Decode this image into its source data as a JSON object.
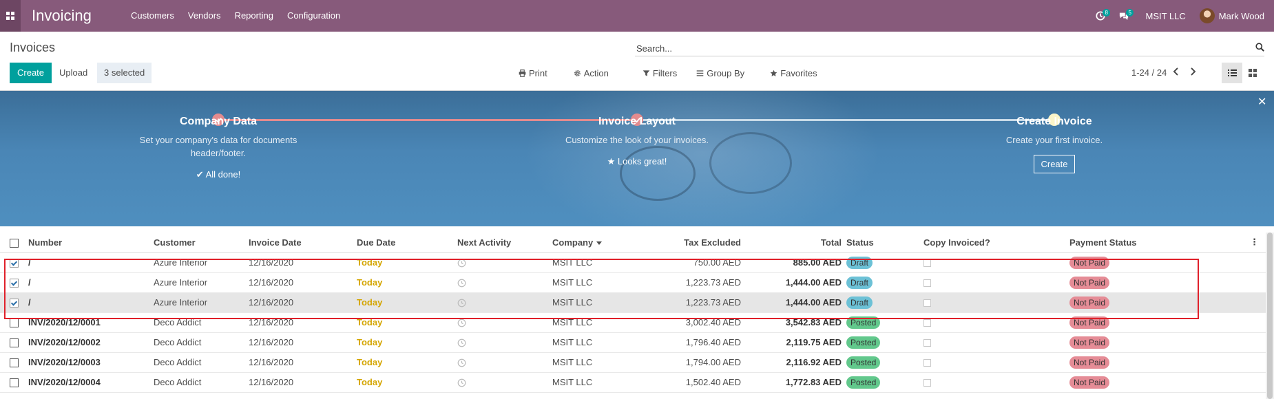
{
  "app": {
    "name": "Invoicing",
    "menu": [
      "Customers",
      "Vendors",
      "Reporting",
      "Configuration"
    ],
    "activity_badge": "8",
    "messages_badge": "5",
    "company": "MSIT LLC",
    "user": "Mark Wood"
  },
  "control_panel": {
    "breadcrumb": "Invoices",
    "search_placeholder": "Search...",
    "create_label": "Create",
    "upload_label": "Upload",
    "selected_label": "3 selected",
    "print_label": "Print",
    "action_label": "Action",
    "filters_label": "Filters",
    "groupby_label": "Group By",
    "favorites_label": "Favorites",
    "pager": "1-24 / 24"
  },
  "onboarding": {
    "steps": [
      {
        "title": "Company Data",
        "description": "Set your company's data for documents header/footer.",
        "status": "✔ All done!"
      },
      {
        "title": "Invoice Layout",
        "description": "Customize the look of your invoices.",
        "status": "★ Looks great!"
      },
      {
        "title": "Create Invoice",
        "description": "Create your first invoice.",
        "button": "Create"
      }
    ]
  },
  "table": {
    "columns": [
      "Number",
      "Customer",
      "Invoice Date",
      "Due Date",
      "Next Activity",
      "Company",
      "Tax Excluded",
      "Total",
      "Status",
      "Copy Invoiced?",
      "Payment Status"
    ],
    "rows": [
      {
        "checked": true,
        "number": "/",
        "customer": "Azure Interior",
        "invoice_date": "12/16/2020",
        "due": "Today",
        "company": "MSIT LLC",
        "tax_excluded": "750.00 AED",
        "total": "885.00 AED",
        "status": "Draft",
        "payment": "Not Paid"
      },
      {
        "checked": true,
        "number": "/",
        "customer": "Azure Interior",
        "invoice_date": "12/16/2020",
        "due": "Today",
        "company": "MSIT LLC",
        "tax_excluded": "1,223.73 AED",
        "total": "1,444.00 AED",
        "status": "Draft",
        "payment": "Not Paid"
      },
      {
        "checked": true,
        "number": "/",
        "customer": "Azure Interior",
        "invoice_date": "12/16/2020",
        "due": "Today",
        "company": "MSIT LLC",
        "tax_excluded": "1,223.73 AED",
        "total": "1,444.00 AED",
        "status": "Draft",
        "payment": "Not Paid"
      },
      {
        "checked": false,
        "number": "INV/2020/12/0001",
        "customer": "Deco Addict",
        "invoice_date": "12/16/2020",
        "due": "Today",
        "company": "MSIT LLC",
        "tax_excluded": "3,002.40 AED",
        "total": "3,542.83 AED",
        "status": "Posted",
        "payment": "Not Paid"
      },
      {
        "checked": false,
        "number": "INV/2020/12/0002",
        "customer": "Deco Addict",
        "invoice_date": "12/16/2020",
        "due": "Today",
        "company": "MSIT LLC",
        "tax_excluded": "1,796.40 AED",
        "total": "2,119.75 AED",
        "status": "Posted",
        "payment": "Not Paid"
      },
      {
        "checked": false,
        "number": "INV/2020/12/0003",
        "customer": "Deco Addict",
        "invoice_date": "12/16/2020",
        "due": "Today",
        "company": "MSIT LLC",
        "tax_excluded": "1,794.00 AED",
        "total": "2,116.92 AED",
        "status": "Posted",
        "payment": "Not Paid"
      },
      {
        "checked": false,
        "number": "INV/2020/12/0004",
        "customer": "Deco Addict",
        "invoice_date": "12/16/2020",
        "due": "Today",
        "company": "MSIT LLC",
        "tax_excluded": "1,502.40 AED",
        "total": "1,772.83 AED",
        "status": "Posted",
        "payment": "Not Paid"
      }
    ]
  },
  "colors": {
    "navbar": "#875a7b",
    "primary": "#00a09d",
    "draft_badge": "#6cc1d6",
    "posted_badge": "#62c88c",
    "notpaid_badge": "#e58c96",
    "due_today": "#d4a500",
    "highlight_box": "#e0202a"
  },
  "icons": [
    "apps-grid-icon",
    "clock-icon",
    "chat-icon",
    "search-icon",
    "print-icon",
    "gear-icon",
    "filter-icon",
    "bars-icon",
    "star-icon",
    "chevron-left-icon",
    "chevron-right-icon",
    "list-view-icon",
    "kanban-view-icon",
    "close-icon",
    "check-icon",
    "options-icon"
  ]
}
